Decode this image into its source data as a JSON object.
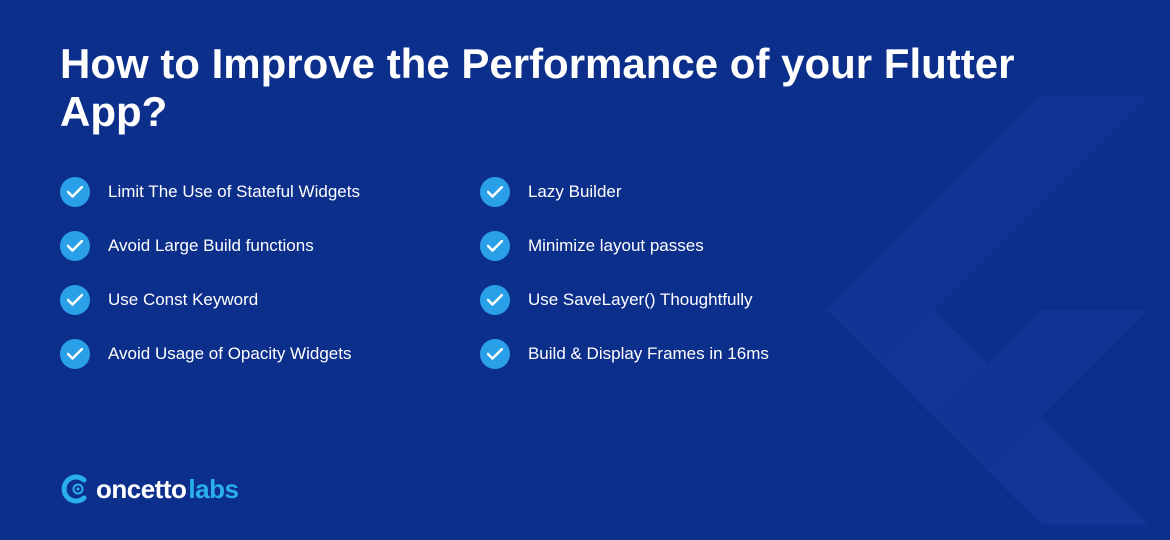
{
  "title": "How to Improve the Performance of your Flutter App?",
  "columns": {
    "left": [
      "Limit The Use of Stateful Widgets",
      "Avoid Large Build functions",
      "Use Const Keyword",
      "Avoid Usage of Opacity Widgets"
    ],
    "right": [
      "Lazy Builder",
      "Minimize layout passes",
      "Use SaveLayer() Thoughtfully",
      "Build & Display Frames in 16ms"
    ]
  },
  "brand": {
    "part1": "oncetto",
    "part2": "labs"
  }
}
